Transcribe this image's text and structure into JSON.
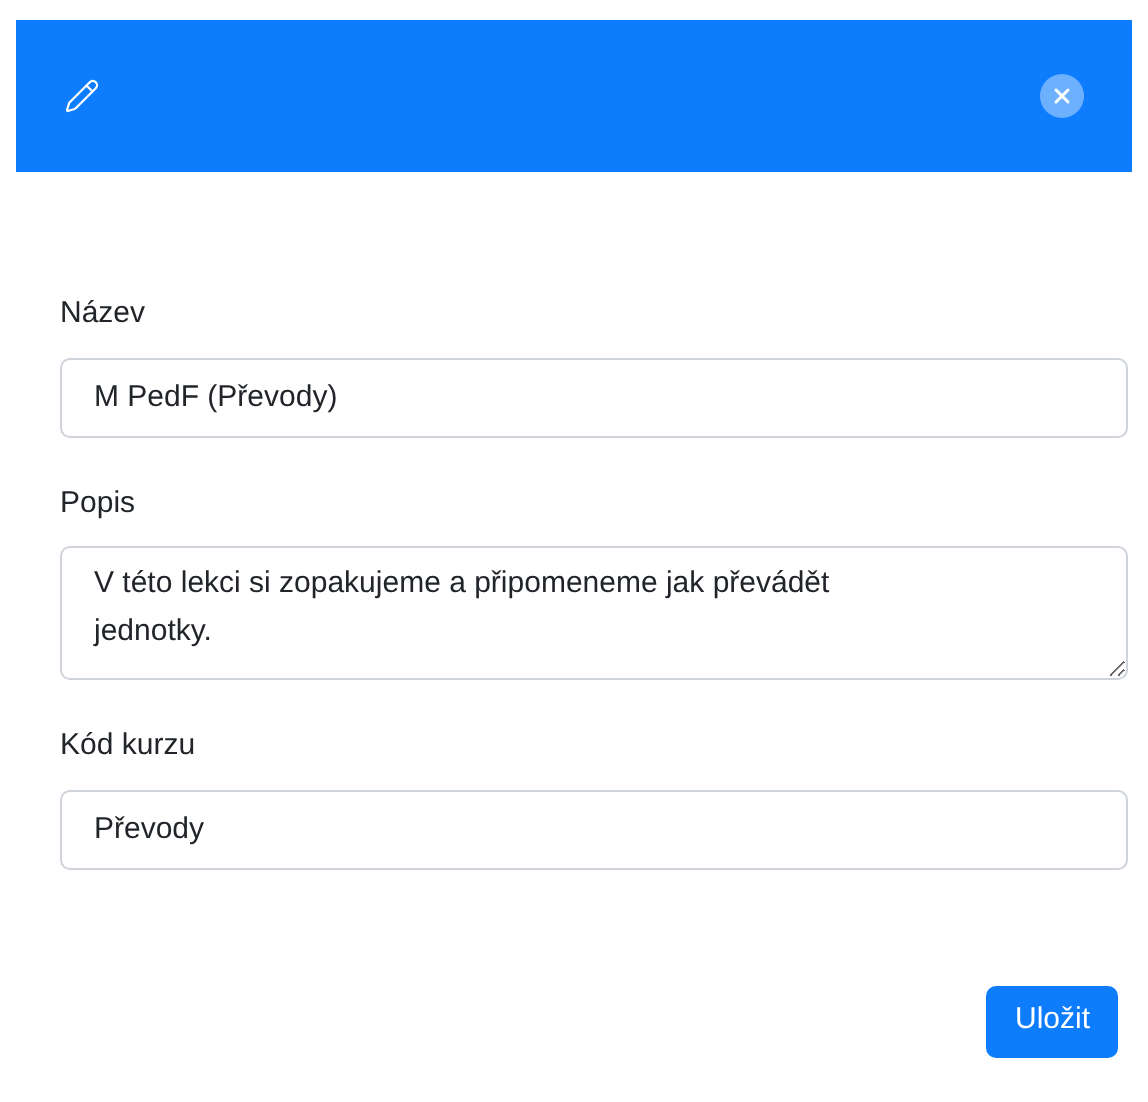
{
  "fields": [
    {
      "kind": "input",
      "label": "Název",
      "value": "M PedF (Převody)"
    },
    {
      "kind": "textarea",
      "label": "Popis",
      "value": "V této lekci si zopakujeme a připomeneme jak převádět jednotky."
    },
    {
      "kind": "input",
      "label": "Kód kurzu",
      "value": "Převody"
    }
  ],
  "save_button": "Uložit"
}
